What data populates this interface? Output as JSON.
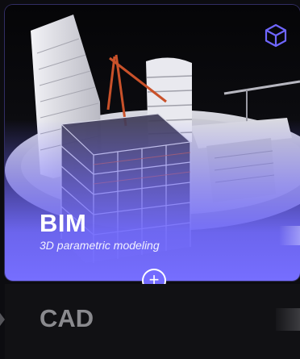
{
  "cards": {
    "bim": {
      "title": "BIM",
      "subtitle": "3D parametric modeling",
      "accent": "#766eff",
      "icon": "cube-icon",
      "action_icon": "plus-icon"
    },
    "cad": {
      "title": "CAD"
    }
  },
  "plus_label": "+"
}
